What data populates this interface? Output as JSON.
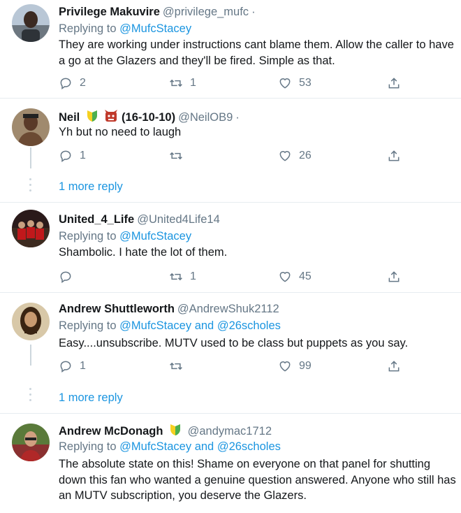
{
  "tweets": [
    {
      "name": "Privilege Makuvire",
      "handle": "@privilege_mufc",
      "reply_prefix": "Replying to",
      "reply_to": "@MufcStacey",
      "reply_and": "",
      "reply_to2": "",
      "text": "They are working under instructions cant blame them. Allow the caller to have a go at the Glazers and they'll be fired. Simple as that.",
      "replies": "2",
      "retweets": "1",
      "likes": "53"
    },
    {
      "name": "Neil",
      "name_suffix": "(16-10-10)",
      "handle": "@NeilOB9",
      "text": "Yh but no need to laugh",
      "replies": "1",
      "retweets": "",
      "likes": "26",
      "more_replies": "1 more reply"
    },
    {
      "name": "United_4_Life",
      "handle": "@United4Life14",
      "reply_prefix": "Replying to",
      "reply_to": "@MufcStacey",
      "text": "Shambolic. I hate the lot of them.",
      "replies": "",
      "retweets": "1",
      "likes": "45"
    },
    {
      "name": "Andrew Shuttleworth",
      "handle": "@AndrewShuk2112",
      "reply_prefix": "Replying to",
      "reply_to": "@MufcStacey",
      "reply_and": "and",
      "reply_to2": "@26scholes",
      "text": "Easy....unsubscribe. MUTV used to be class but puppets as you say.",
      "replies": "1",
      "retweets": "",
      "likes": "99",
      "more_replies": "1 more reply"
    },
    {
      "name": "Andrew McDonagh",
      "handle": "@andymac1712",
      "reply_prefix": "Replying to",
      "reply_to": "@MufcStacey",
      "reply_and": "and",
      "reply_to2": "@26scholes",
      "text": "The absolute state on this! Shame on everyone on that panel for shutting down this fan who wanted a genuine question answered. Anyone who still has an MUTV subscription, you deserve the Glazers."
    }
  ],
  "colors": {
    "link": "#1b95e0",
    "muted": "#657786",
    "text": "#14171a",
    "divider": "#e6ecf0"
  },
  "icons": [
    "reply-icon",
    "retweet-icon",
    "like-icon",
    "share-icon",
    "verified-shield-icon",
    "devil-emoji-icon"
  ]
}
